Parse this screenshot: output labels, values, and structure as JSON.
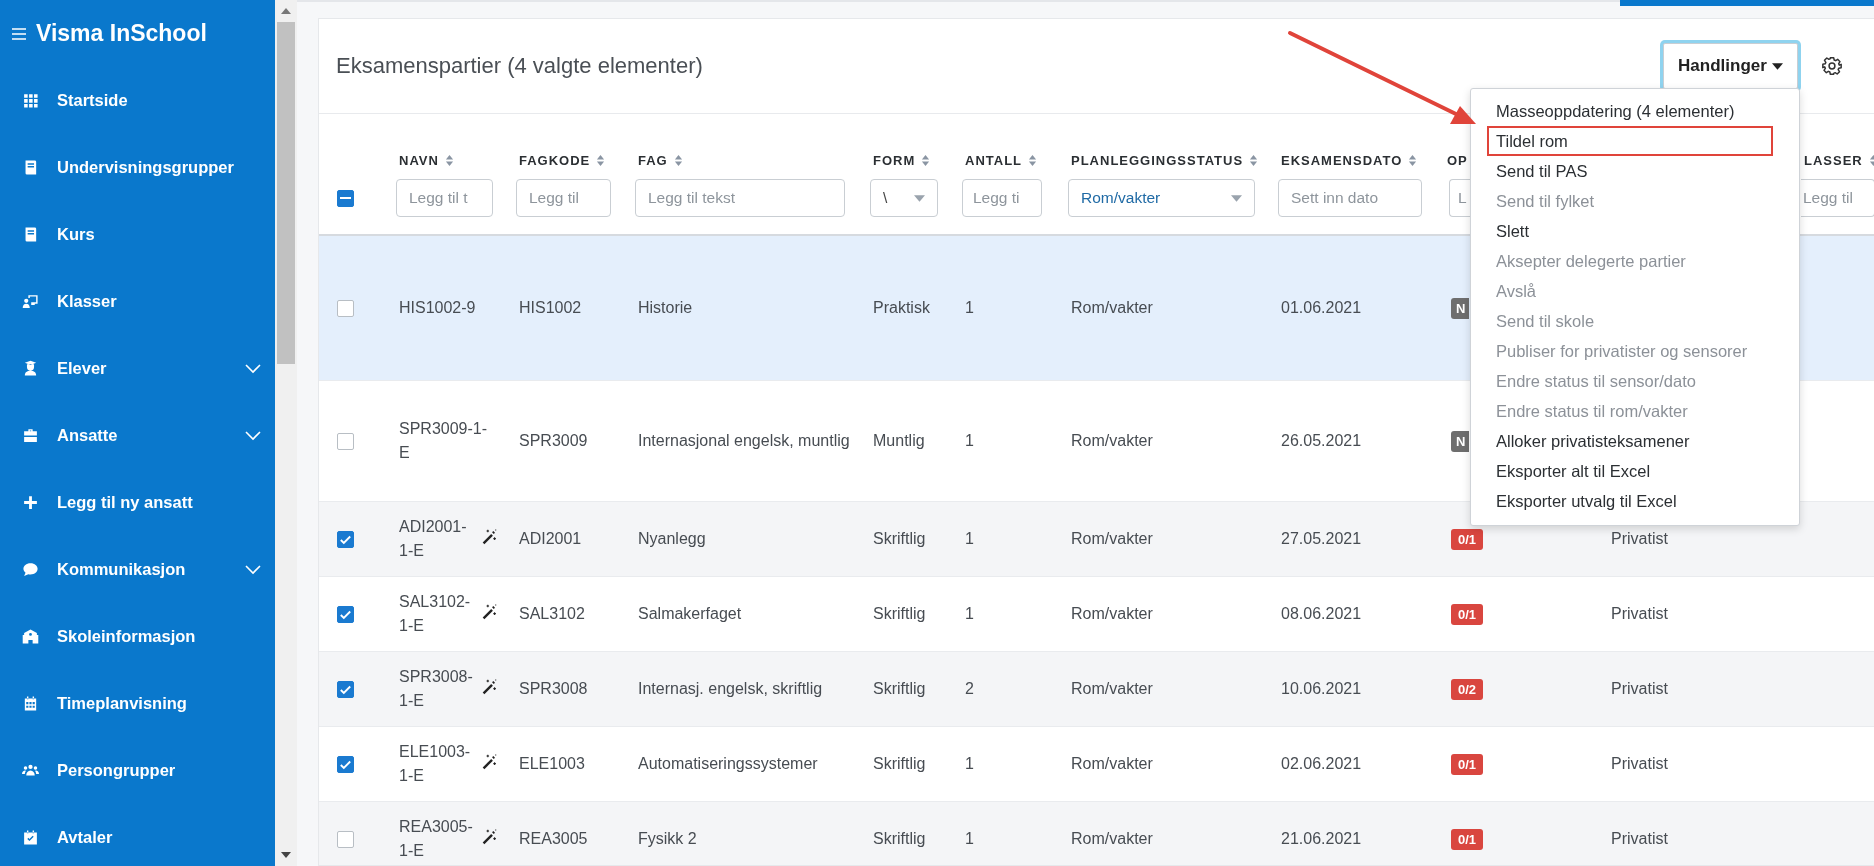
{
  "app": {
    "title": "Visma InSchool"
  },
  "sidebar": {
    "items": [
      {
        "label": "Startside",
        "expandable": false
      },
      {
        "label": "Undervisningsgrupper",
        "expandable": false
      },
      {
        "label": "Kurs",
        "expandable": false
      },
      {
        "label": "Klasser",
        "expandable": false
      },
      {
        "label": "Elever",
        "expandable": true
      },
      {
        "label": "Ansatte",
        "expandable": true
      },
      {
        "label": "Legg til ny ansatt",
        "expandable": false
      },
      {
        "label": "Kommunikasjon",
        "expandable": true
      },
      {
        "label": "Skoleinformasjon",
        "expandable": false
      },
      {
        "label": "Timeplanvisning",
        "expandable": false
      },
      {
        "label": "Persongrupper",
        "expandable": false
      },
      {
        "label": "Avtaler",
        "expandable": false
      }
    ]
  },
  "panel": {
    "title": "Eksamenspartier (4 valgte elementer)",
    "actions_button": "Handlinger",
    "actions_menu": {
      "open": true,
      "items": [
        {
          "label": "Masseoppdatering (4 elementer)",
          "disabled": false,
          "highlighted": false
        },
        {
          "label": "Tildel rom",
          "disabled": false,
          "highlighted": true
        },
        {
          "label": "Send til PAS",
          "disabled": false,
          "highlighted": false
        },
        {
          "label": "Send til fylket",
          "disabled": true,
          "highlighted": false
        },
        {
          "label": "Slett",
          "disabled": false,
          "highlighted": false
        },
        {
          "label": "Aksepter delegerte partier",
          "disabled": true,
          "highlighted": false
        },
        {
          "label": "Avslå",
          "disabled": true,
          "highlighted": false
        },
        {
          "label": "Send til skole",
          "disabled": true,
          "highlighted": false
        },
        {
          "label": "Publiser for privatister og sensorer",
          "disabled": true,
          "highlighted": false
        },
        {
          "label": "Endre status til sensor/dato",
          "disabled": true,
          "highlighted": false
        },
        {
          "label": "Endre status til rom/vakter",
          "disabled": true,
          "highlighted": false
        },
        {
          "label": "Alloker privatisteksamener",
          "disabled": false,
          "highlighted": false
        },
        {
          "label": "Eksporter alt til Excel",
          "disabled": false,
          "highlighted": false
        },
        {
          "label": "Eksporter utvalg til Excel",
          "disabled": false,
          "highlighted": false
        }
      ]
    }
  },
  "table": {
    "select_all": {
      "indeterminate": true
    },
    "columns": [
      {
        "label": "NAVN",
        "sortable": true,
        "filter": {
          "kind": "text",
          "placeholder": "Legg til t"
        }
      },
      {
        "label": "FAGKODE",
        "sortable": true,
        "filter": {
          "kind": "text",
          "placeholder": "Legg til"
        }
      },
      {
        "label": "FAG",
        "sortable": true,
        "filter": {
          "kind": "text",
          "placeholder": "Legg til tekst"
        }
      },
      {
        "label": "FORM",
        "sortable": true,
        "filter": {
          "kind": "select",
          "value": "\\"
        }
      },
      {
        "label": "ANTALL",
        "sortable": true,
        "filter": {
          "kind": "text",
          "placeholder": "Legg ti"
        }
      },
      {
        "label": "PLANLEGGINGSSTATUS",
        "sortable": true,
        "filter": {
          "kind": "select",
          "value": "Rom/vakter"
        }
      },
      {
        "label": "EKSAMENSDATO",
        "sortable": true,
        "filter": {
          "kind": "text",
          "placeholder": "Sett inn dato"
        }
      },
      {
        "label": "OP",
        "sortable": false,
        "filter": {
          "kind": "text",
          "placeholder": "L"
        }
      },
      {},
      {
        "label": "LASSER",
        "sortable": true,
        "filter": {
          "kind": "text",
          "placeholder": "Legg til"
        }
      }
    ],
    "rows": [
      {
        "checked": false,
        "highlighted": true,
        "name": "HIS1002-9",
        "wand": false,
        "code": "HIS1002",
        "subject": "Historie",
        "form": "Praktisk",
        "count": "1",
        "status": "Rom/vakter",
        "date": "01.06.2021",
        "badge": {
          "text": "N",
          "color": "#6e6e6e"
        }
      },
      {
        "checked": false,
        "highlighted": false,
        "name": "SPR3009-1-E",
        "wand": false,
        "code": "SPR3009",
        "subject": "Internasjonal engelsk, muntlig",
        "form": "Muntlig",
        "count": "1",
        "status": "Rom/vakter",
        "date": "26.05.2021",
        "badge": {
          "text": "N",
          "color": "#6e6e6e"
        }
      },
      {
        "checked": true,
        "highlighted": false,
        "name": "ADI2001-1-E",
        "wand": true,
        "code": "ADI2001",
        "subject": "Nyanlegg",
        "form": "Skriftlig",
        "count": "1",
        "status": "Rom/vakter",
        "date": "27.05.2021",
        "badge": {
          "text": "0/1",
          "color": "#d9463f"
        },
        "column_10": "Privatist"
      },
      {
        "checked": true,
        "highlighted": false,
        "name": "SAL3102-1-E",
        "wand": true,
        "code": "SAL3102",
        "subject": "Salmakerfaget",
        "form": "Skriftlig",
        "count": "1",
        "status": "Rom/vakter",
        "date": "08.06.2021",
        "badge": {
          "text": "0/1",
          "color": "#d9463f"
        },
        "column_10": "Privatist"
      },
      {
        "checked": true,
        "highlighted": false,
        "name": "SPR3008-1-E",
        "wand": true,
        "code": "SPR3008",
        "subject": "Internasj. engelsk, skriftlig",
        "form": "Skriftlig",
        "count": "2",
        "status": "Rom/vakter",
        "date": "10.06.2021",
        "badge": {
          "text": "0/2",
          "color": "#d9463f"
        },
        "column_10": "Privatist"
      },
      {
        "checked": true,
        "highlighted": false,
        "name": "ELE1003-1-E",
        "wand": true,
        "code": "ELE1003",
        "subject": "Automatiseringssystemer",
        "form": "Skriftlig",
        "count": "1",
        "status": "Rom/vakter",
        "date": "02.06.2021",
        "badge": {
          "text": "0/1",
          "color": "#d9463f"
        },
        "column_10": "Privatist"
      },
      {
        "checked": false,
        "highlighted": false,
        "name": "REA3005-1-E",
        "wand": true,
        "code": "REA3005",
        "subject": "Fysikk 2",
        "form": "Skriftlig",
        "count": "1",
        "status": "Rom/vakter",
        "date": "21.06.2021",
        "badge": {
          "text": "0/1",
          "color": "#d9463f"
        },
        "column_10": "Privatist"
      }
    ]
  }
}
